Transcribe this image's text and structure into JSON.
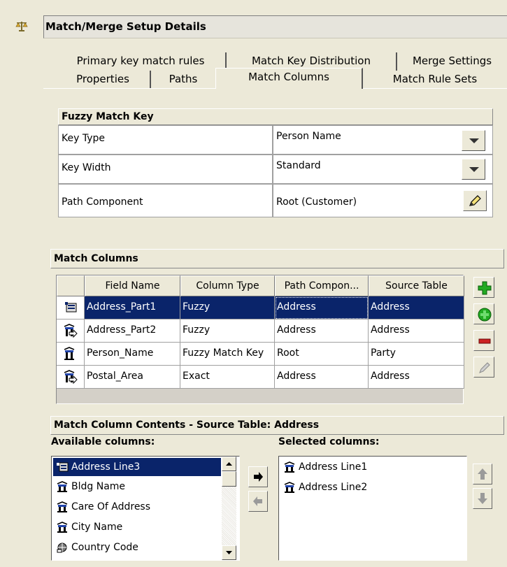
{
  "title": "Match/Merge Setup Details",
  "tabs_back": [
    "Primary key match rules",
    "Match Key Distribution",
    "Merge Settings"
  ],
  "tabs_front": [
    "Properties",
    "Paths",
    "Match Columns",
    "Match Rule Sets"
  ],
  "active_tab": "Match Columns",
  "fuzzy": {
    "header": "Fuzzy Match Key",
    "rows": [
      {
        "label": "Key Type",
        "value": "Person Name",
        "control": "dropdown"
      },
      {
        "label": "Key Width",
        "value": "Standard",
        "control": "dropdown"
      },
      {
        "label": "Path Component",
        "value": "Root (Customer)",
        "control": "edit"
      }
    ]
  },
  "match_columns": {
    "header": "Match Columns",
    "columns": [
      "Field Name",
      "Column Type",
      "Path Compon...",
      "Source Table"
    ],
    "rows": [
      {
        "field": "Address_Part1",
        "type": "Fuzzy",
        "path": "Address",
        "source": "Address",
        "selected": true
      },
      {
        "field": "Address_Part2",
        "type": "Fuzzy",
        "path": "Address",
        "source": "Address",
        "selected": false
      },
      {
        "field": "Person_Name",
        "type": "Fuzzy Match Key",
        "path": "Root",
        "source": "Party",
        "selected": false
      },
      {
        "field": "Postal_Area",
        "type": "Exact",
        "path": "Address",
        "source": "Address",
        "selected": false
      }
    ]
  },
  "contents": {
    "header": "Match Column Contents - Source Table: Address",
    "available_label": "Available columns:",
    "selected_label": "Selected columns:",
    "available": [
      "Address Line3",
      "Bldg Name",
      "Care Of Address",
      "City Name",
      "Country Code"
    ],
    "selected": [
      "Address Line1",
      "Address Line2"
    ]
  },
  "icons": {
    "add": "plus-icon",
    "add_green": "plus-circle-icon",
    "remove": "minus-icon",
    "edit": "pencil-icon"
  },
  "colors": {
    "selection": "#0a246a",
    "plus_green": "#22aa22",
    "minus_red": "#cc2222"
  }
}
